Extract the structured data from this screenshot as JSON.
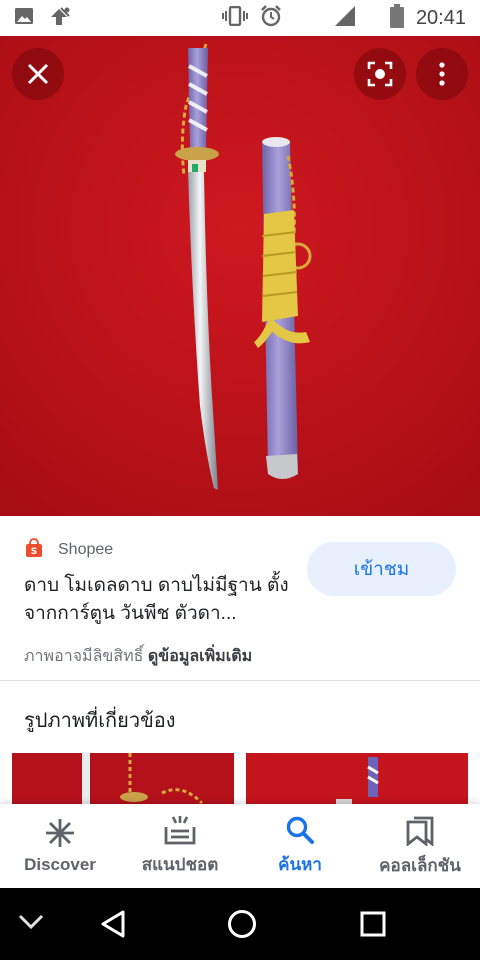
{
  "status_bar": {
    "time": "20:41"
  },
  "source": {
    "name": "Shopee",
    "icon": "shopee-icon",
    "accent": "#ee4d2d"
  },
  "visit_button": {
    "label": "เข้าชม"
  },
  "product": {
    "title": "ดาบ โมเดลดาบ ดาบไม่มีฐาน ตั้ง จากการ์ตูน วันพีช ตัวดา..."
  },
  "copyright": {
    "notice": "ภาพอาจมีลิขสิทธิ์",
    "more_info": "ดูข้อมูลเพิ่มเติม"
  },
  "related": {
    "title": "รูปภาพที่เกี่ยวข้อง"
  },
  "bottom_nav": {
    "items": [
      {
        "label": "Discover",
        "icon": "asterisk-icon"
      },
      {
        "label": "สแนปชอต",
        "icon": "snapshot-icon"
      },
      {
        "label": "ค้นหา",
        "icon": "search-icon"
      },
      {
        "label": "คอลเล็กชัน",
        "icon": "bookmarks-icon"
      }
    ],
    "active": "ค้นหา"
  },
  "colors": {
    "accent": "#1a73e8",
    "image_background": "#c4141c",
    "chip_background": "#e8f0fe"
  }
}
